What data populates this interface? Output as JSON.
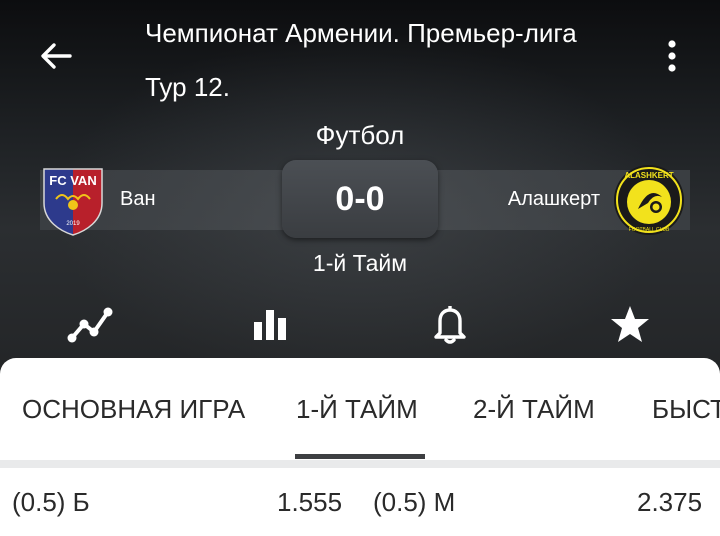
{
  "header": {
    "tournament": "Чемпионат Армении. Премьер-лига",
    "round": "Тур 12.",
    "sport": "Футбол",
    "period": "1-й Тайм",
    "score": "0-0"
  },
  "home_team": {
    "name": "Ван",
    "logo_text": "FC VAN",
    "logo_year": "2019"
  },
  "away_team": {
    "name": "Алашкерт",
    "logo_text": "ALASHKERT",
    "logo_subtext": "FOOTBALL CLUB"
  },
  "actions": [
    "stats-icon",
    "bar-chart-icon",
    "bell-icon",
    "star-icon"
  ],
  "tabs": {
    "items": [
      "ОСНОВНАЯ ИГРА",
      "1-Й ТАЙМ",
      "2-Й ТАЙМ",
      "БЫСТ"
    ],
    "active_index": 1
  },
  "odds": [
    {
      "label": "(0.5) Б",
      "value": "1.555"
    },
    {
      "label": "(0.5) М",
      "value": "2.375"
    }
  ],
  "colors": {
    "header_dark": "#1e2124",
    "score_box": "#42464a",
    "tab_indicator": "#3d3f42",
    "away_logo_yellow": "#f2e21c",
    "home_logo_red": "#b8202b",
    "home_logo_blue": "#2d3a8c"
  }
}
